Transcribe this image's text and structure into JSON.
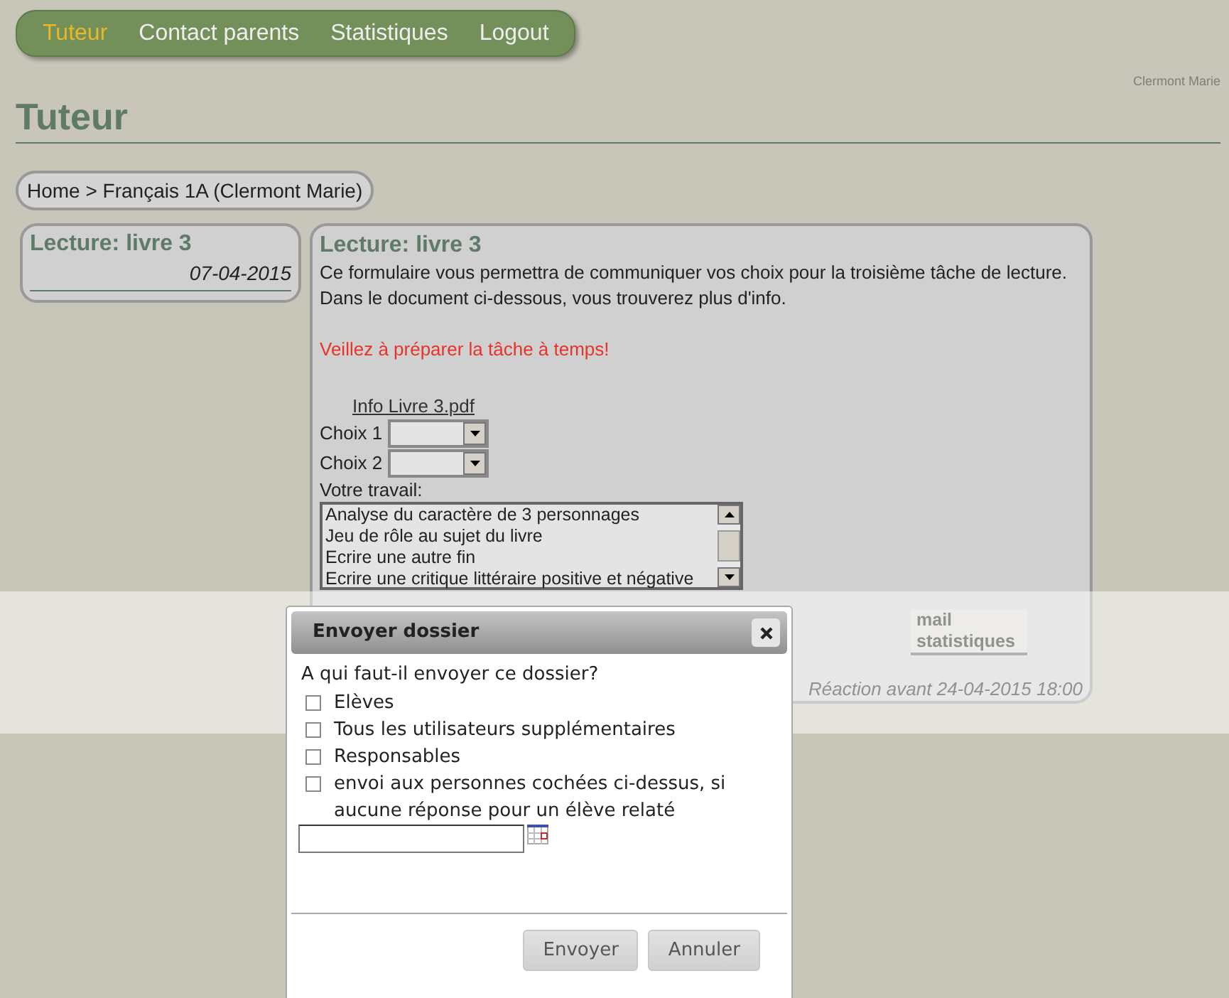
{
  "nav": [
    {
      "label": "Tuteur",
      "selected": true
    },
    {
      "label": "Contact parents",
      "selected": false
    },
    {
      "label": "Statistiques",
      "selected": false
    },
    {
      "label": "Logout",
      "selected": false
    }
  ],
  "user": "Clermont Marie",
  "page_title": "Tuteur",
  "breadcrumb": "Home > Français 1A (Clermont Marie)",
  "task_list": [
    {
      "title": "Lecture: livre 3",
      "date": "07-04-2015"
    }
  ],
  "task": {
    "title": "Lecture: livre 3",
    "paragraphs": [
      "Ce formulaire vous permettra de communiquer vos choix pour la troisième tâche de lecture.",
      "Dans le document ci-dessous, vous trouverez plus d'info."
    ],
    "warning": "Veillez à préparer la tâche à temps!",
    "attachment": "Info Livre 3.pdf",
    "choices": [
      {
        "label": "Choix 1"
      },
      {
        "label": "Choix 2"
      }
    ],
    "work_label": "Votre travail:",
    "work_options": [
      "Analyse du caractère de 3 personnages",
      "Jeu de rôle au sujet du livre",
      "Ecrire une autre fin",
      "Ecrire une critique littéraire positive et négative"
    ],
    "action": "mail statistiques",
    "deadline": "Réaction avant 24-04-2015 18:00"
  },
  "dialog": {
    "title": "Envoyer dossier",
    "question": "A qui faut-il envoyer ce dossier?",
    "options": [
      {
        "label": "Elèves",
        "checked": false
      },
      {
        "label": "Tous les utilisateurs supplémentaires",
        "checked": false
      },
      {
        "label": "Responsables",
        "checked": false
      },
      {
        "label": "envoi aux personnes cochées ci-dessus, si aucune réponse pour un élève relaté",
        "checked": false
      }
    ],
    "buttons": [
      "Envoyer",
      "Annuler"
    ]
  }
}
